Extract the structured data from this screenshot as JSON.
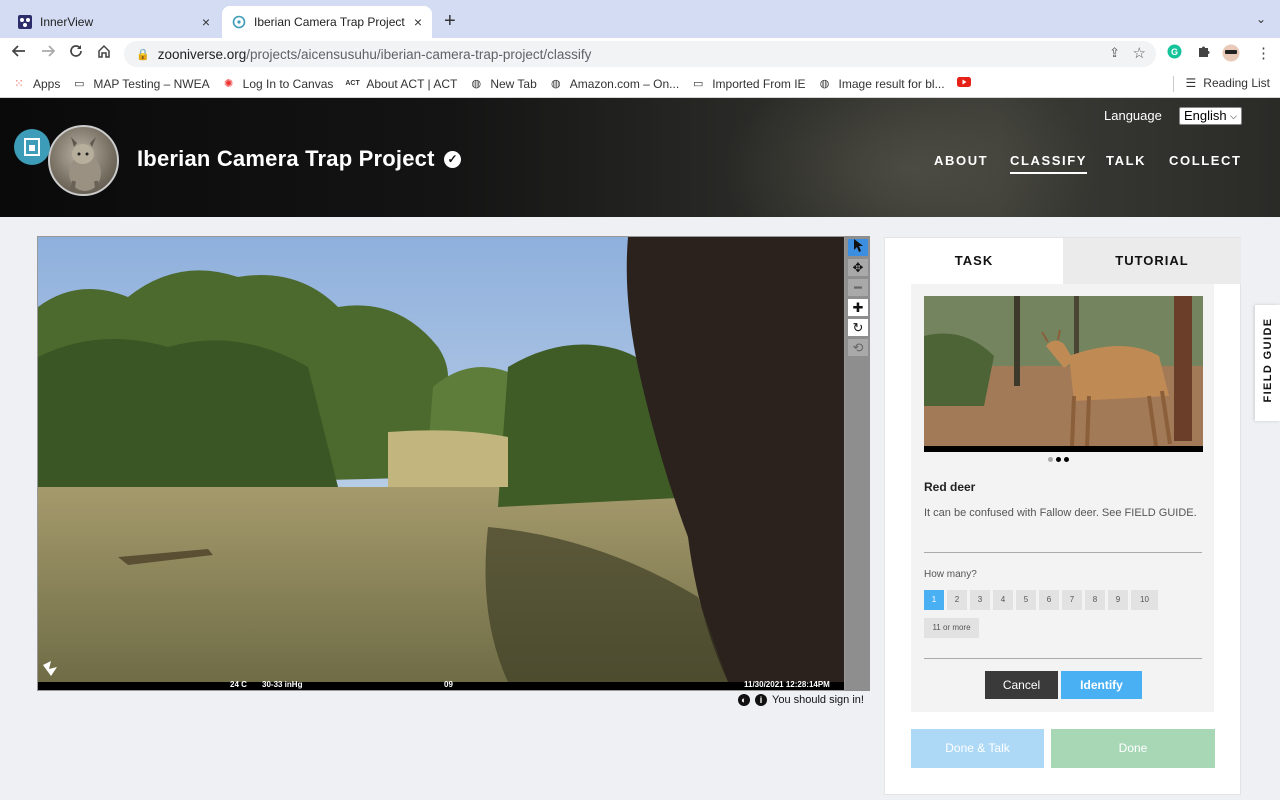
{
  "browser": {
    "tabs": [
      {
        "title": "InnerView",
        "close": "×"
      },
      {
        "title": "Iberian Camera Trap Project » ·",
        "close": "×"
      }
    ],
    "new_tab": "+",
    "tab_menu": "⌄",
    "url_host": "zooniverse.org",
    "url_path": "/projects/aicensusuhu/iberian-camera-trap-project/classify",
    "bookmarks": [
      {
        "label": "Apps",
        "icon": "apps-grid-icon"
      },
      {
        "label": "MAP Testing – NWEA",
        "icon": "folder-icon"
      },
      {
        "label": "Log In to Canvas",
        "icon": "canvas-icon"
      },
      {
        "label": "About ACT | ACT",
        "icon": "act-icon"
      },
      {
        "label": "New Tab",
        "icon": "globe-icon"
      },
      {
        "label": "Amazon.com – On...",
        "icon": "globe-icon"
      },
      {
        "label": "Imported From IE",
        "icon": "folder-icon"
      },
      {
        "label": "Image result for bl...",
        "icon": "globe-icon"
      },
      {
        "label": "",
        "icon": "youtube-icon"
      }
    ],
    "reading_list": "Reading List"
  },
  "header": {
    "project_title": "Iberian Camera Trap Project",
    "language_label": "Language",
    "language_value": "English",
    "nav": [
      "ABOUT",
      "CLASSIFY",
      "TALK",
      "COLLECT"
    ],
    "active_nav": "CLASSIFY"
  },
  "viewer": {
    "info_strip": {
      "temp": "24 C",
      "pressure": "30-33 inHg",
      "frame": "09",
      "datetime": "11/30/2021 12:28:14PM"
    },
    "tools": [
      "pointer-icon",
      "pan-icon",
      "zoom-out-icon",
      "zoom-in-icon",
      "rotate-icon",
      "reset-icon"
    ],
    "signin_text": "You should sign in!"
  },
  "task_panel": {
    "tabs": [
      "TASK",
      "TUTORIAL"
    ],
    "species_name": "Red deer",
    "species_desc": "It can be confused with Fallow deer. See FIELD GUIDE.",
    "how_many_label": "How many?",
    "counts": [
      "1",
      "2",
      "3",
      "4",
      "5",
      "6",
      "7",
      "8",
      "9",
      "10"
    ],
    "selected_count": "1",
    "more_label": "11 or more",
    "cancel_label": "Cancel",
    "identify_label": "Identify",
    "done_talk_label": "Done & Talk",
    "done_label": "Done",
    "image_pages": 3,
    "image_page_active": 2
  },
  "field_guide_label": "FIELD GUIDE",
  "colors": {
    "accent_blue": "#4ab0f4",
    "done_green": "#a8d7b6",
    "done_talk_blue": "#aed9f6",
    "tool_selected": "#3c8fe0"
  }
}
